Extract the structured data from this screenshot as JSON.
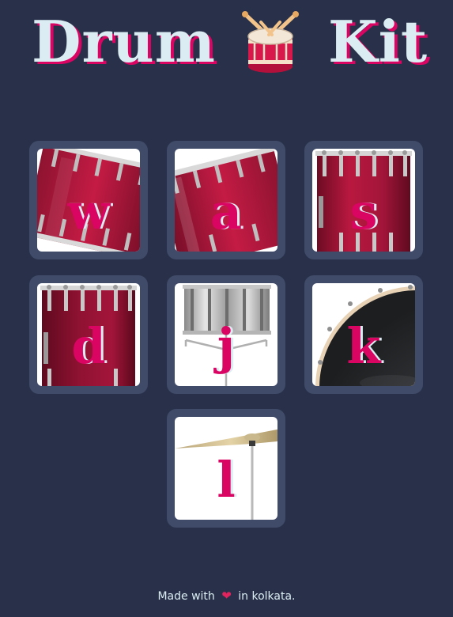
{
  "header": {
    "title_left": "Drum",
    "title_right": "Kit",
    "logo_icon": "drum-icon"
  },
  "drums": [
    {
      "key": "w",
      "sound": "tom-1",
      "icon": "tom-drum-tilted-icon"
    },
    {
      "key": "a",
      "sound": "tom-2",
      "icon": "tom-drum-tilted-icon"
    },
    {
      "key": "s",
      "sound": "tom-3",
      "icon": "floor-tom-icon"
    },
    {
      "key": "d",
      "sound": "tom-4",
      "icon": "floor-tom-icon"
    },
    {
      "key": "j",
      "sound": "snare",
      "icon": "snare-drum-icon"
    },
    {
      "key": "k",
      "sound": "crash",
      "icon": "bass-drum-icon"
    },
    {
      "key": "l",
      "sound": "kick-bass",
      "icon": "cymbal-icon"
    }
  ],
  "footer": {
    "prefix": "Made with",
    "heart_icon": "heart-icon",
    "suffix": "in kolkata."
  },
  "colors": {
    "background": "#283149",
    "tile": "#404b69",
    "accent": "#da0463",
    "text": "#dbedf3"
  }
}
